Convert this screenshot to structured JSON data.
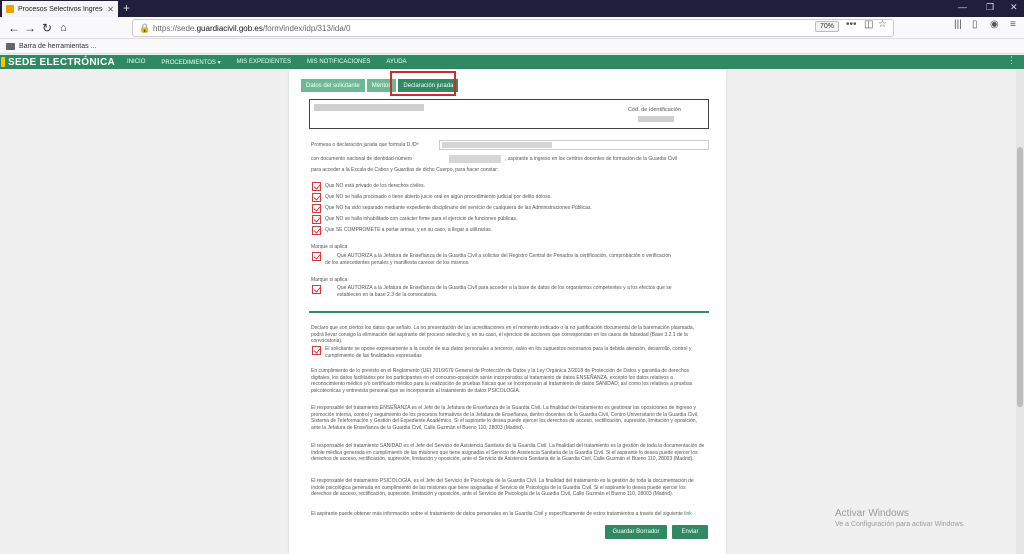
{
  "browser": {
    "tab_title": "Procesos Selectivos Ingreso GC",
    "url_prefix": "https://sede.",
    "url_domain": "guardiacivil.gob.es",
    "url_path": "/form/index/idp/313/ida/0",
    "zoom": "70%",
    "bookmark": "Barra de herramientas ..."
  },
  "site": {
    "logo": "SEDE ELECTRÓNICA",
    "menu": [
      "INICIO",
      "PROCEDIMIENTOS ▾",
      "MIS EXPEDIENTES",
      "MIS NOTIFICACIONES",
      "AYUDA"
    ]
  },
  "tabs": [
    "Datos del solicitante",
    "Méritos",
    "Declaración jurada"
  ],
  "form": {
    "cod_label": "Cód. de Identificación",
    "promesa": "Promesa o declaración jurada que formula D./Dª",
    "dni_pre": "con documento nacional de identidad número",
    "dni_post": ", aspirante a ingreso en los centros docentes de formación de la Guardia Civil",
    "dni_line2": "para acceder a la Escala de Cabos y Guardias de dicho Cuerpo, para hacer constar:",
    "checks": [
      "Que NO está privado de los derechos civiles.",
      "Que NO se halla procesado o tiene abierto juicio oral en algún procedimiento judicial por delito doloso.",
      "Que NO ha sido separado mediante expediente disciplinario del servicio de cualquiera de las Administraciones Públicas.",
      "Que NO se halla inhabilitado con carácter firme para el ejercicio de funciones públicas.",
      "Que SE COMPROMETE a portar armas, y en su caso, a llegar a utilizarlas."
    ],
    "marque1": "Marque si aplica",
    "autoriza1_l1": "Que AUTORIZA a la Jefatura de Enseñanza de la Guardia Civil a solicitar del Registro Central de Penados la certificación, comprobación o verificación",
    "autoriza1_l2": "de los antecedentes penales y manifiesta carecer de los mismos.",
    "marque2": "Marque si aplica",
    "autoriza2_l1": "Que AUTORIZA a la Jefatura de Enseñanza de la Guardia Civil para acceder a la base de datos de los organismos competentes y a los efectos que se",
    "autoriza2_l2": "establecen en la base 2.3 de la convocatoria.",
    "declaro": "Declaro que son ciertos los datos que señalo. La no presentación de las acreditaciones en el momento indicado o la no justificación documental de la baremación plasmada, podrá llevar consigo la eliminación del aspirante del proceso selectivo y, en su caso, el ejercicio de acciones que correspondan en los casos de falsedad (Base 3.2.1 de la convocatoria).",
    "opone": "El solicitante se opone expresamente a la cesión de sus datos personales a terceros, salvo en los supuestos necesarios para la debida atención, desarrollo, control y cumplimiento de las finalidades expresadas",
    "p1": "En cumplimiento de lo previsto en el Reglamento (UE) 2016/679 General de Protección de Datos y la Ley Orgánica 3/2018 de Protección de Datos y garantía de derechos digitales, los datos facilitados por los participantes en el concurso-oposición serán incorporados al tratamiento de datos ENSEÑANZA, excepto los datos relativos a reconocimiento médico y/o certificado médico para la realización de pruebas físicas que se incorporarán al tratamiento de datos SANIDAD; así como los relativos a pruebas psicotécnicas y entrevista personal que se incorporarán al tratamiento de datos PSICOLOGÍA.",
    "p2": "El responsable del tratamiento ENSEÑANZA es el Jefe de la Jefatura de Enseñanza de la Guardia Civil. La finalidad del tratamiento es gestionar las oposiciones de ingreso y promoción interna, control y seguimiento de los procesos formativos de la Jefatura de Enseñanza, dentro docentes de la Guardia Civil, Centro Universitario de la Guardia Civil, Sistema de Teleformación y Gestión del Expediente Académico. Si el aspirante lo desea puede ejercer los derechos de acceso, rectificación, supresión, limitación y oposición, ante la Jefatura de Enseñanza de la Guardia Civil, Calle Guzmán el Bueno 110, 28003 (Madrid).",
    "p3": "El responsable del tratamiento SANIDAD es el Jefe del Servicio de Asistencia Sanitaria de la Guardia Civil. La finalidad del tratamiento es la gestión de toda la documentación de índole médica generada en cumplimiento de las misiones que tiene asignadas el Servicio de Asistencia Sanitaria de la Guardia Civil. Si el aspirante lo desea puede ejercer los derechos de acceso, rectificación, supresión, limitación y oposición, ante el Servicio de Asistencia Sanitaria de la Guardia Civil, Calle Guzmán el Bueno 110, 28003 (Madrid).",
    "p4": "El responsable del tratamiento PSICOLOGÍA, es el Jefe del Servicio de Psicología de la Guardia Civil. La finalidad del tratamiento es la gestión de toda la documentación de índole psicológica generada en cumplimiento de las misiones que tiene asignadas el Servicio de Psicología de la Guardia Civil. Si el aspirante lo desea puede ejercer los derechos de acceso, rectificación, supresión, limitación y oposición, ante el Servicio de Psicología de la Guardia Civil, Calle Guzmán el Bueno 110, 28003 (Madrid).",
    "p5": "El aspirante puede obtener más información sobre el tratamiento de datos personales en la Guardia Civil y específicamente de estos tratamientos a través del siguiente",
    "p5_link": "link",
    "btn_save": "Guardar Borrador",
    "btn_send": "Enviar"
  },
  "os": {
    "activate_title": "Activar Windows",
    "activate_sub": "Ve a Configuración para activar Windows."
  }
}
